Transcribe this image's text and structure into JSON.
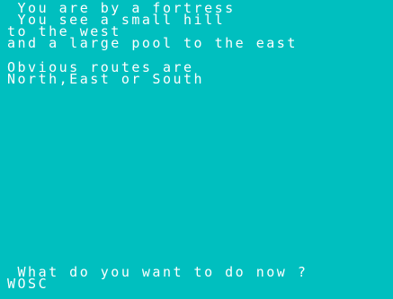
{
  "window": {
    "background_color": "#00bfbf",
    "text_color": "#ffffff"
  },
  "description": {
    "lines": [
      " You are by a fortress",
      " You see a small hill",
      "to the west",
      "and a large pool to the east"
    ]
  },
  "routes": {
    "lines": [
      "Obvious routes are",
      "North,East or South"
    ]
  },
  "prompt": {
    "question": " What do you want to do now ?",
    "input_value": "WOSC"
  }
}
